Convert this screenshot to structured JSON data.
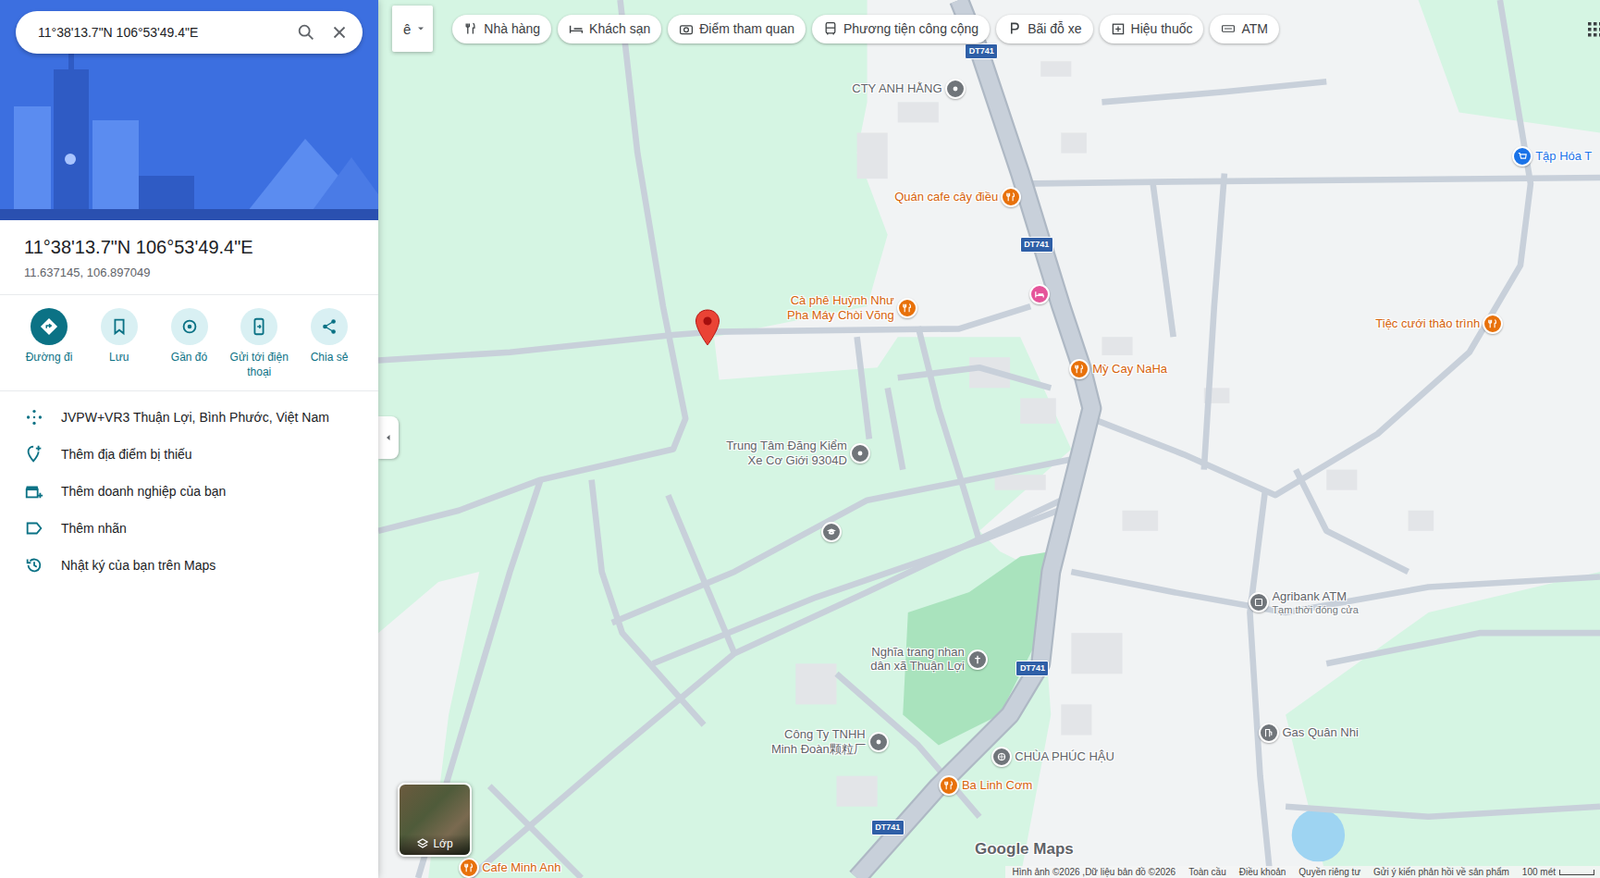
{
  "search": {
    "value": "11°38'13.7\"N 106°53'49.4\"E"
  },
  "place": {
    "title": "11°38'13.7\"N 106°53'49.4\"E",
    "coords": "11.637145, 106.897049"
  },
  "actions": [
    {
      "label": "Đường đi",
      "kind": "directions",
      "selected": true
    },
    {
      "label": "Lưu",
      "kind": "save",
      "selected": false
    },
    {
      "label": "Gần đó",
      "kind": "nearby",
      "selected": false
    },
    {
      "label": "Gửi tới điện thoại",
      "kind": "send",
      "selected": false
    },
    {
      "label": "Chia sẻ",
      "kind": "share",
      "selected": false
    }
  ],
  "details": [
    {
      "label": "JVPW+VR3 Thuận Lợi, Bình Phước, Việt Nam",
      "kind": "pluscode"
    },
    {
      "label": "Thêm địa điểm bị thiếu",
      "kind": "addplace"
    },
    {
      "label": "Thêm doanh nghiệp của bạn",
      "kind": "business"
    },
    {
      "label": "Thêm nhãn",
      "kind": "label"
    },
    {
      "label": "Nhật ký của bạn trên Maps",
      "kind": "history"
    }
  ],
  "map_type_button": {
    "label": "ê"
  },
  "chips": [
    {
      "label": "Nhà hàng",
      "kind": "restaurant"
    },
    {
      "label": "Khách sạn",
      "kind": "hotel"
    },
    {
      "label": "Điểm tham quan",
      "kind": "camera"
    },
    {
      "label": "Phương tiện công cộng",
      "kind": "transit"
    },
    {
      "label": "Bãi đỗ xe",
      "kind": "parking"
    },
    {
      "label": "Hiệu thuốc",
      "kind": "pharmacy"
    },
    {
      "label": "ATM",
      "kind": "atm"
    }
  ],
  "pois": [
    {
      "lines": [
        "CTY ANH HẰNG"
      ],
      "kind": "business",
      "color": "#70757a"
    },
    {
      "lines": [
        "Quán cafe cây điều"
      ],
      "kind": "food",
      "color": "#e8710a"
    },
    {
      "lines": [
        "Cà phê Huỳnh Như",
        "Pha Máy Chòi Võng"
      ],
      "kind": "food",
      "color": "#e8710a"
    },
    {
      "lines": [],
      "kind": "lodging",
      "color": "#e5549a"
    },
    {
      "lines": [
        "Mỳ Cay NaHa"
      ],
      "kind": "food",
      "color": "#e8710a"
    },
    {
      "lines": [
        "Tiệc cưới thảo trình"
      ],
      "kind": "food",
      "color": "#e8710a"
    },
    {
      "lines": [
        "Tập Hóa T"
      ],
      "kind": "shop",
      "color": "#1a73e8"
    },
    {
      "lines": [
        "Trung Tâm Đăng Kiểm",
        "Xe Cơ Giới 9304D"
      ],
      "kind": "business",
      "color": "#70757a"
    },
    {
      "lines": [],
      "kind": "school",
      "color": "#70757a"
    },
    {
      "lines": [
        "Nghĩa trang nhan",
        "dân xã Thuận Lợi"
      ],
      "kind": "cemetery",
      "color": "#70757a"
    },
    {
      "lines": [
        "Công Ty TNHH",
        "Minh Đoàn颗粒厂"
      ],
      "kind": "business",
      "color": "#70757a"
    },
    {
      "lines": [
        "CHÙA PHÚC HẬU"
      ],
      "kind": "worship",
      "color": "#70757a"
    },
    {
      "lines": [
        "Ba Linh Cơm"
      ],
      "kind": "food",
      "color": "#e8710a"
    },
    {
      "lines": [
        "Cafe Minh Anh"
      ],
      "kind": "food",
      "color": "#e8710a"
    },
    {
      "lines": [
        "Agribank ATM",
        "Tạm thời đóng cửa"
      ],
      "kind": "atm",
      "color": "#70757a"
    },
    {
      "lines": [
        "Gas Quân Nhi"
      ],
      "kind": "gas",
      "color": "#70757a"
    }
  ],
  "road_shields": [
    "DT741",
    "DT741",
    "DT741",
    "DT741"
  ],
  "layers_button": {
    "label": "Lớp"
  },
  "logo": "Google Maps",
  "footer": [
    "Hình ảnh ©2026 ,Dữ liệu bản đồ ©2026",
    "Toàn cầu",
    "Điều khoản",
    "Quyền riêng tư",
    "Gửi ý kiến phản hồi về sản phẩm"
  ],
  "scale": "100 mét"
}
